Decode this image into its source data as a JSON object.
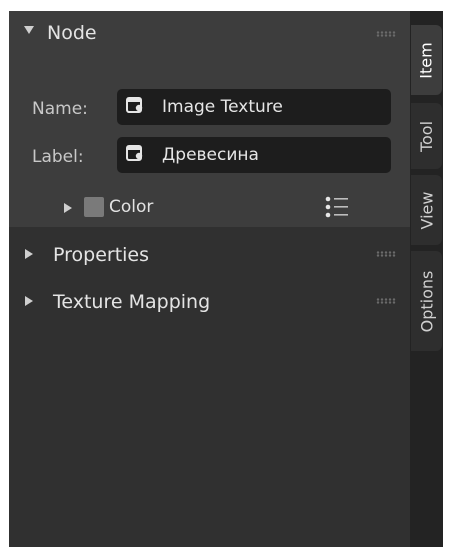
{
  "panel": {
    "node_section": {
      "title": "Node",
      "name_label": "Name:",
      "name_value": "Image Texture",
      "label_label": "Label:",
      "label_value": "Древесина",
      "color_label": "Color"
    },
    "properties_title": "Properties",
    "texture_mapping_title": "Texture Mapping"
  },
  "tabs": [
    {
      "label": "Item",
      "active": true
    },
    {
      "label": "Tool",
      "active": false
    },
    {
      "label": "View",
      "active": false
    },
    {
      "label": "Options",
      "active": false
    }
  ],
  "icons": {
    "node_expand": "triangle-down-icon",
    "collapsed": "triangle-right-icon",
    "field_icon": "node-icon",
    "list": "list-icon",
    "grip": "drag-handle-icon"
  },
  "colors": {
    "panel_bg": "#303030",
    "section_bg": "#3d3d3d",
    "field_bg": "#1d1d1d",
    "tab_strip_bg": "#232323",
    "color_swatch": "#7a7a7a"
  }
}
